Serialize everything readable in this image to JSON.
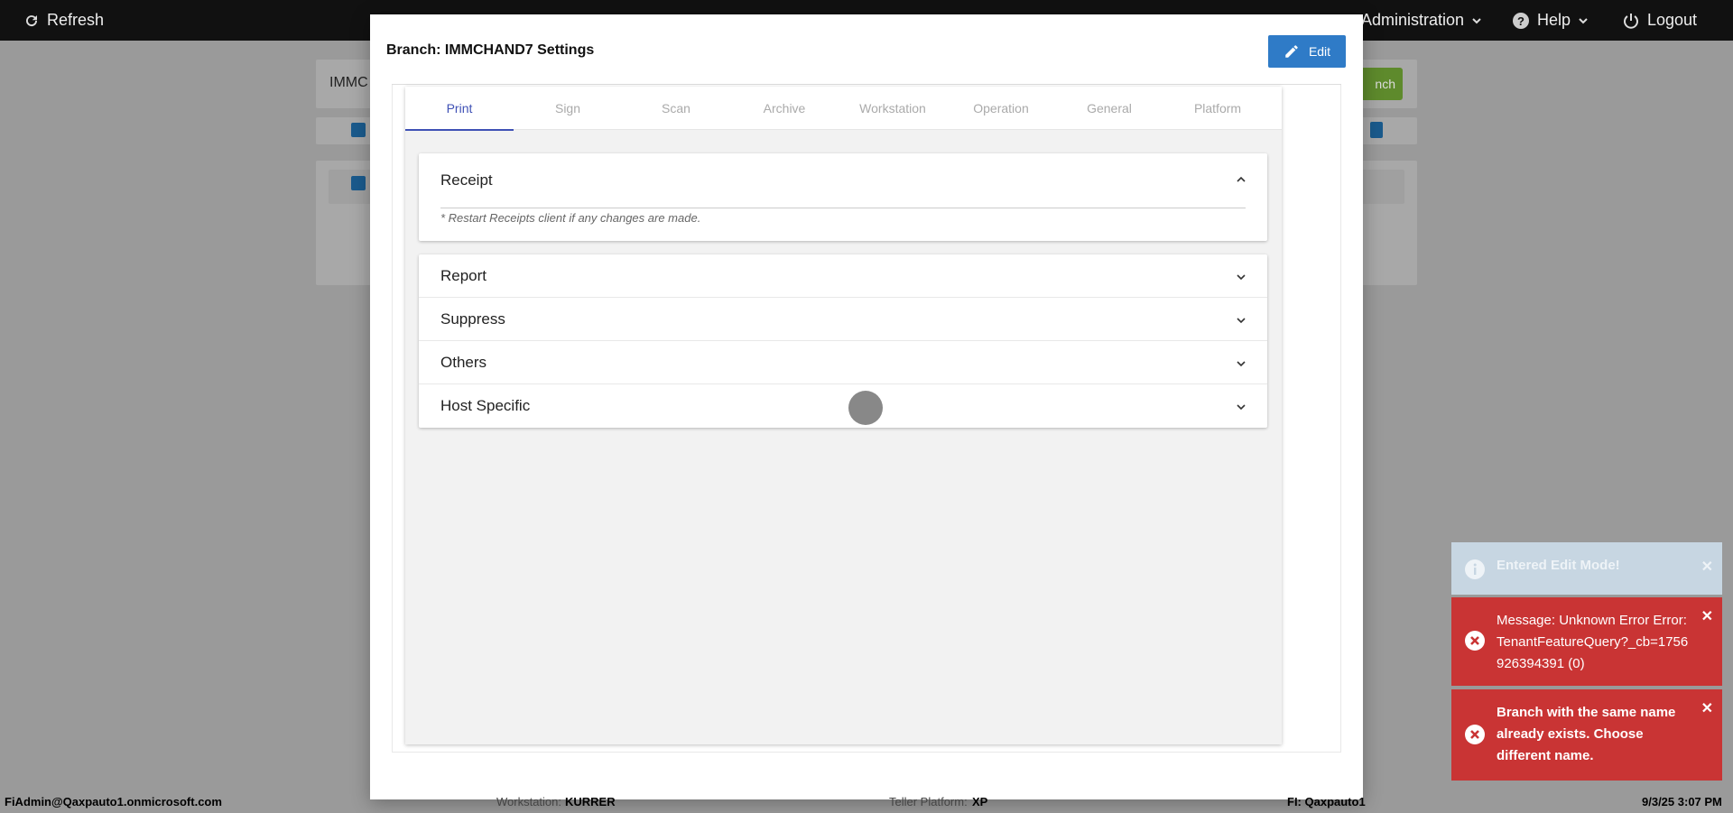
{
  "topbar": {
    "refresh_label": "Refresh",
    "administration_label": "Administration",
    "help_label": "Help",
    "logout_label": "Logout"
  },
  "background": {
    "search_value": "IMMC",
    "add_branch_label": "nch"
  },
  "modal": {
    "title": "Branch: IMMCHAND7 Settings",
    "edit_label": "Edit",
    "tabs": [
      {
        "label": "Print",
        "active": true
      },
      {
        "label": "Sign",
        "active": false
      },
      {
        "label": "Scan",
        "active": false
      },
      {
        "label": "Archive",
        "active": false
      },
      {
        "label": "Workstation",
        "active": false
      },
      {
        "label": "Operation",
        "active": false
      },
      {
        "label": "General",
        "active": false
      },
      {
        "label": "Platform",
        "active": false
      }
    ],
    "receipt": {
      "title": "Receipt",
      "note": "* Restart Receipts client if any changes are made."
    },
    "sections": [
      {
        "label": "Report"
      },
      {
        "label": "Suppress"
      },
      {
        "label": "Others"
      },
      {
        "label": "Host Specific"
      }
    ]
  },
  "toasts": {
    "info": "Entered Edit Mode!",
    "error1": "Message: Unknown Error Error: TenantFeatureQuery?_cb=1756926394391 (0)",
    "error2": "Branch with the same name already exists. Choose different name."
  },
  "statusbar": {
    "user": "FiAdmin@Qaxpauto1.onmicrosoft.com",
    "workstation_label": "Workstation:",
    "workstation_value": "KURRER",
    "platform_label": "Teller Platform:",
    "platform_value": "XP",
    "fi": "FI: Qaxpauto1",
    "datetime": "9/3/25 3:07 PM"
  },
  "colors": {
    "primary": "#2f7bc7",
    "tab_active": "#3f51b5",
    "error": "#c93434",
    "info": "#c7d6e2"
  }
}
